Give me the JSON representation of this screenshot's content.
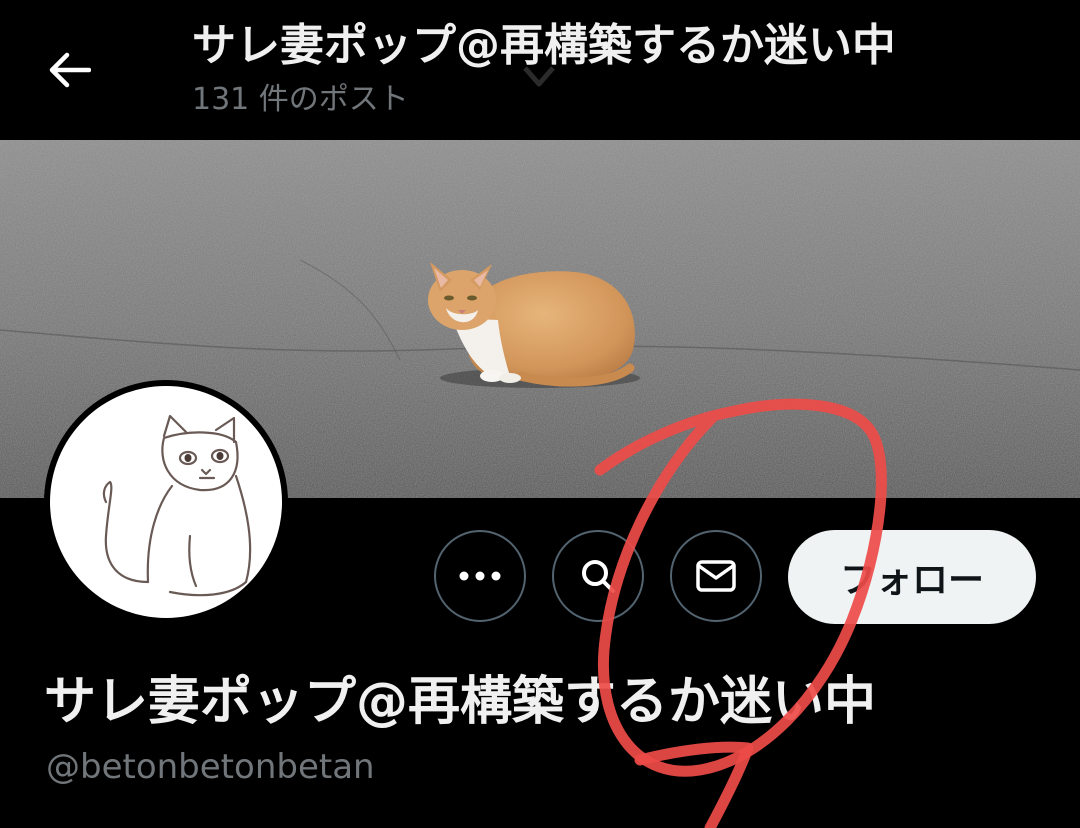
{
  "header": {
    "title": "サレ妻ポップ@再構築するか迷い中",
    "post_count": "131 件のポスト"
  },
  "actions": {
    "more_icon": "more-icon",
    "search_icon": "search-icon",
    "message_icon": "mail-icon",
    "follow_label": "フォロー"
  },
  "profile": {
    "name": "サレ妻ポップ@再構築するか迷い中",
    "handle": "@betonbetonbetan"
  },
  "colors": {
    "background": "#000000",
    "follow_button": "#eff3f4",
    "secondary_text": "#71767b",
    "annotation_red": "#ee4b48"
  }
}
